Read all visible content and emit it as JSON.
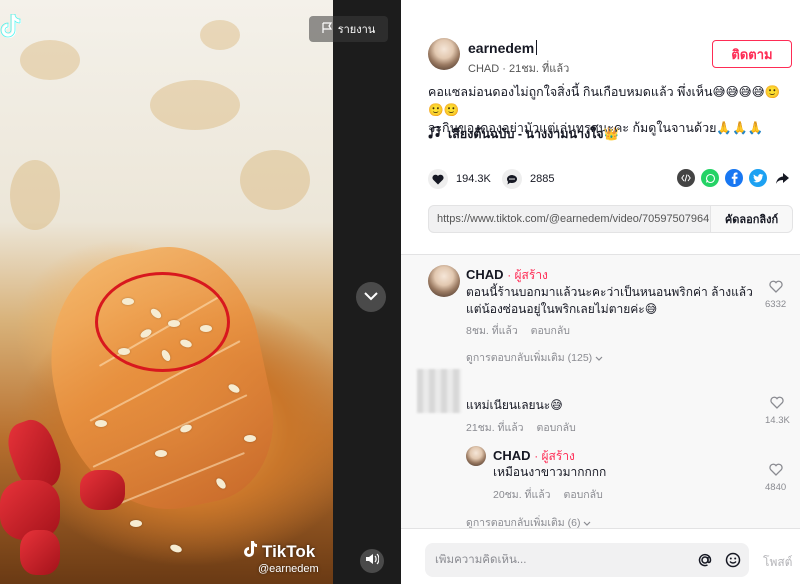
{
  "video": {
    "report_label": "รายงาน",
    "watermark_brand": "TikTok",
    "watermark_handle": "@earnedem"
  },
  "author": {
    "name": "earnedem",
    "display_name": "CHAD",
    "time_ago": "21ชม. ที่แล้ว",
    "follow_label": "ติดตาม"
  },
  "caption": {
    "line1": "คอแซลม่อนดองไม่ถูกใจสิ่งนี้ กินเกือบหมดแล้ว พึ่งเห็น😅😅😅😅🙂🙂🙂",
    "line2": "จะกินของดองอย่ามัวแต่เล่นทรศนะคะ ก้มดูในจานด้วย🙏🙏🙏"
  },
  "music": {
    "label": "เสียงต้นฉบับ - นางงามนางใจ👑"
  },
  "stats": {
    "likes": "194.3K",
    "comments": "2885"
  },
  "link": {
    "url": "https://www.tiktok.com/@earnedem/video/70597507964...",
    "copy_label": "คัดลอกลิงก์"
  },
  "comments": [
    {
      "name": "CHAD",
      "creator_badge": "· ผู้สร้าง",
      "text": "ตอนนี้ร้านบอกมาแล้วนะคะว่าเป็นหนอนพริกค่า ล้างแล้ว แต่น้องซ่อนอยู่ในพริกเลยไม่ตายค่ะ😅",
      "time": "8ชม. ที่แล้ว",
      "reply_label": "ตอบกลับ",
      "likes": "6332",
      "view_replies": "ดูการตอบกลับเพิ่มเติม (125)"
    },
    {
      "text": "แหม่เนียนเลยนะ😅",
      "time": "21ชม. ที่แล้ว",
      "reply_label": "ตอบกลับ",
      "likes": "14.3K"
    },
    {
      "name": "CHAD",
      "creator_badge": "· ผู้สร้าง",
      "text": "เหมือนงาขาวมากกกก",
      "time": "20ชม. ที่แล้ว",
      "reply_label": "ตอบกลับ",
      "likes": "4840",
      "view_replies": "ดูการตอบกลับเพิ่มเติม (6)"
    }
  ],
  "composer": {
    "placeholder": "เพิ่มความคิดเห็น...",
    "post_label": "โพสต์"
  },
  "colors": {
    "accent": "#fe2c55",
    "whatsapp": "#25d366",
    "facebook": "#1877f2",
    "twitter": "#1da1f2"
  }
}
